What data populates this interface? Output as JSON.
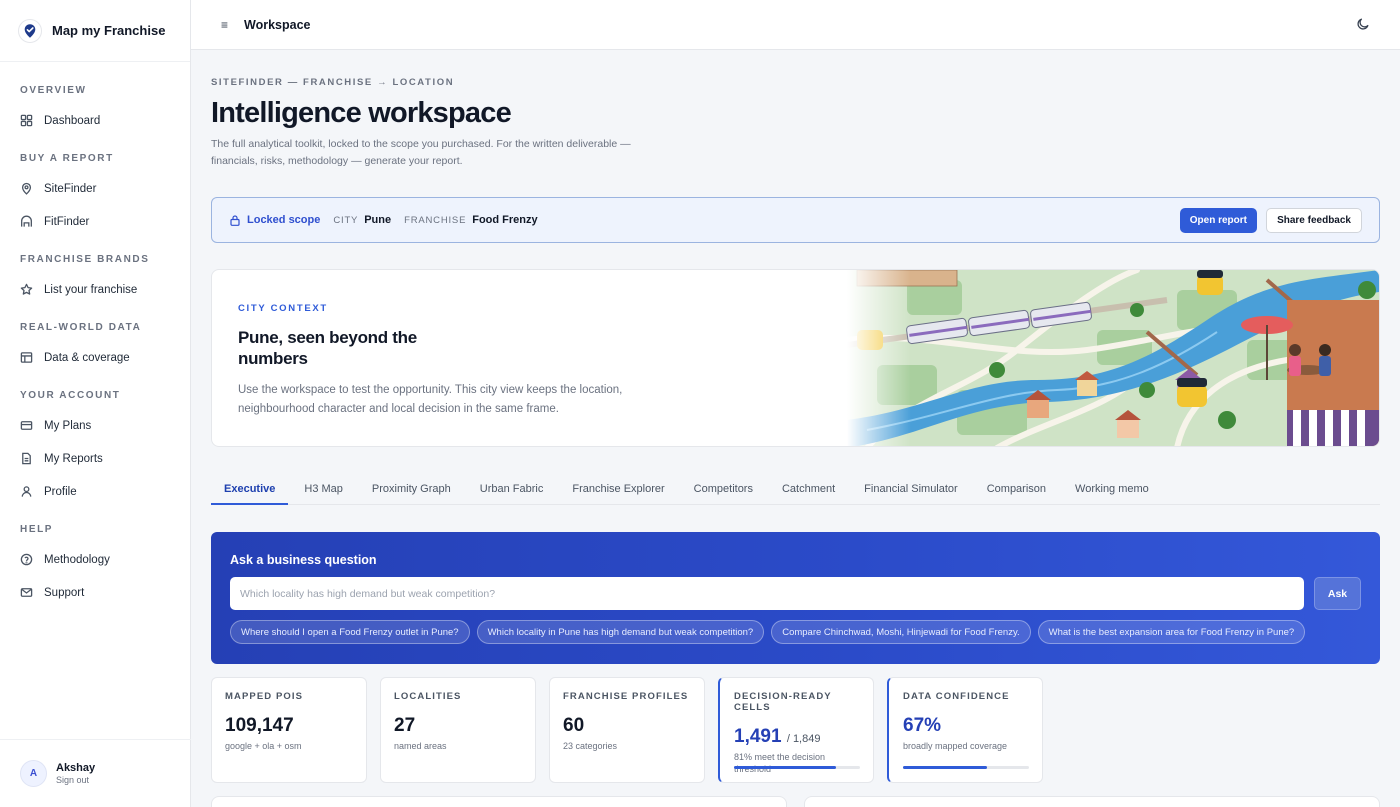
{
  "brand": {
    "title": "Map my Franchise"
  },
  "sidebar": {
    "sections": [
      {
        "title": "OVERVIEW",
        "items": [
          {
            "label": "Dashboard",
            "icon": "dashboard-icon"
          }
        ]
      },
      {
        "title": "BUY A REPORT",
        "items": [
          {
            "label": "SiteFinder",
            "icon": "map-pin-icon"
          },
          {
            "label": "FitFinder",
            "icon": "storefront-icon"
          }
        ]
      },
      {
        "title": "FRANCHISE BRANDS",
        "items": [
          {
            "label": "List your franchise",
            "icon": "star-icon"
          }
        ]
      },
      {
        "title": "REAL-WORLD DATA",
        "items": [
          {
            "label": "Data & coverage",
            "icon": "table-icon"
          }
        ]
      },
      {
        "title": "YOUR ACCOUNT",
        "items": [
          {
            "label": "My Plans",
            "icon": "credit-card-icon"
          },
          {
            "label": "My Reports",
            "icon": "document-icon"
          },
          {
            "label": "Profile",
            "icon": "user-icon"
          }
        ]
      },
      {
        "title": "HELP",
        "items": [
          {
            "label": "Methodology",
            "icon": "help-circle-icon"
          },
          {
            "label": "Support",
            "icon": "mail-icon"
          }
        ]
      }
    ],
    "user": {
      "initial": "A",
      "name": "Akshay",
      "action": "Sign out"
    }
  },
  "topbar": {
    "menu_glyph": "≡",
    "title": "Workspace",
    "theme_icon": "moon-icon"
  },
  "header": {
    "eyebrow": "SITEFINDER — FRANCHISE → LOCATION",
    "title": "Intelligence workspace",
    "description": "The full analytical toolkit, locked to the scope you purchased. For the written deliverable — financials, risks, methodology — generate your report."
  },
  "scope": {
    "label": "Locked scope",
    "city_key": "CITY",
    "city": "Pune",
    "franchise_key": "FRANCHISE",
    "franchise": "Food Frenzy",
    "open_report": "Open report",
    "share_feedback": "Share feedback"
  },
  "city_context": {
    "eyebrow": "CITY CONTEXT",
    "title": "Pune, seen beyond the numbers",
    "description": "Use the workspace to test the opportunity. This city view keeps the location, neighbourhood character and local decision in the same frame."
  },
  "tabs": [
    {
      "label": "Executive",
      "active": true
    },
    {
      "label": "H3 Map"
    },
    {
      "label": "Proximity Graph"
    },
    {
      "label": "Urban Fabric"
    },
    {
      "label": "Franchise Explorer"
    },
    {
      "label": "Competitors"
    },
    {
      "label": "Catchment"
    },
    {
      "label": "Financial Simulator"
    },
    {
      "label": "Comparison"
    },
    {
      "label": "Working memo"
    }
  ],
  "ask": {
    "title": "Ask a business question",
    "placeholder": "Which locality has high demand but weak competition?",
    "button": "Ask",
    "suggestions": [
      "Where should I open a Food Frenzy outlet in Pune?",
      "Which locality in Pune has high demand but weak competition?",
      "Compare Chinchwad, Moshi, Hinjewadi for Food Frenzy.",
      "What is the best expansion area for Food Frenzy in Pune?"
    ]
  },
  "stats": [
    {
      "label": "MAPPED POIS",
      "value": "109,147",
      "sub": "google + ola + osm"
    },
    {
      "label": "LOCALITIES",
      "value": "27",
      "sub": "named areas"
    },
    {
      "label": "FRANCHISE PROFILES",
      "value": "60",
      "sub": "23 categories"
    },
    {
      "label": "DECISION-READY CELLS",
      "value": "1,491",
      "suffix": "/ 1,849",
      "sub": "81% meet the decision threshold",
      "progress": 0.81,
      "accent": true
    },
    {
      "label": "DATA CONFIDENCE",
      "value": "67%",
      "sub": "broadly mapped coverage",
      "progress": 0.67,
      "accent": true
    }
  ]
}
